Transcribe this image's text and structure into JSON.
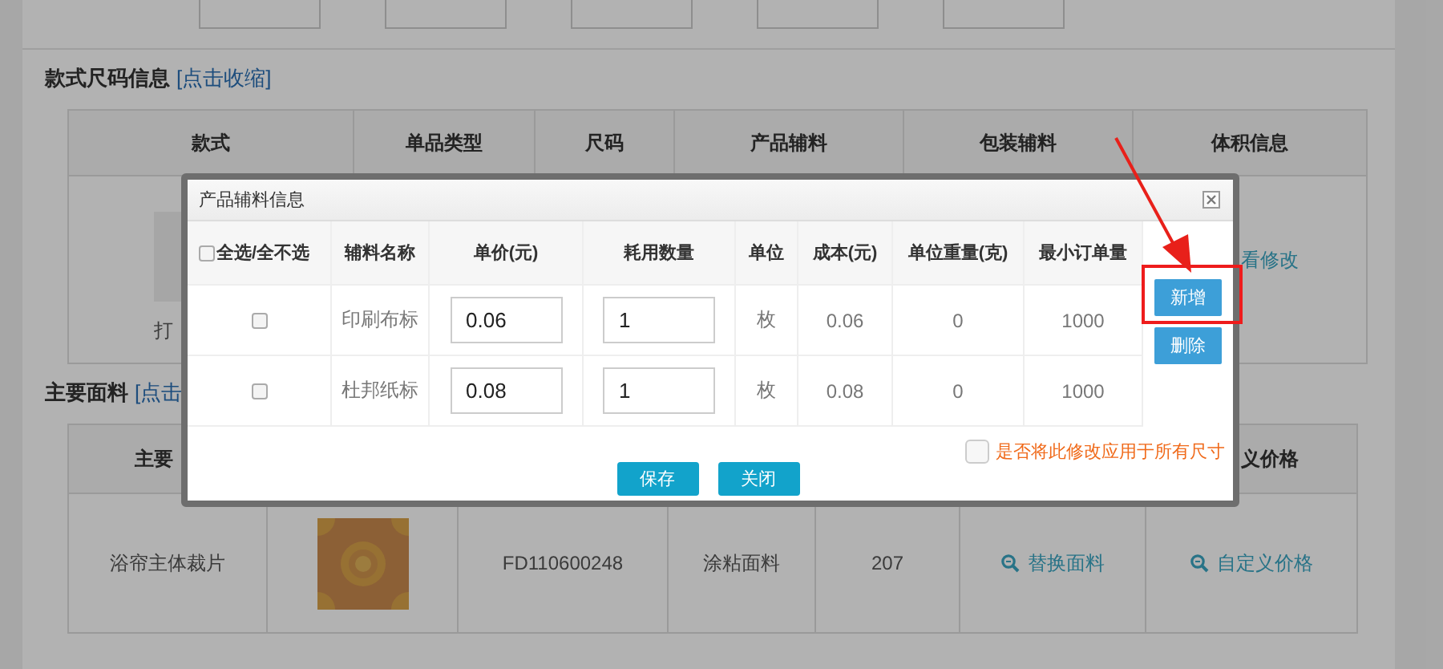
{
  "sections": [
    {
      "title": "款式尺码信息",
      "link": "[点击收缩]",
      "header": [
        {
          "kind": "text",
          "label": "款式"
        },
        {
          "kind": "text",
          "label": "单品类型"
        },
        {
          "kind": "text",
          "label": "尺码"
        },
        {
          "kind": "text",
          "label": "产品辅料"
        },
        {
          "kind": "text",
          "label": "包装辅料"
        },
        {
          "kind": "text",
          "label": "体积信息"
        }
      ],
      "rows": [
        [
          {
            "kind": "image_text",
            "text": "打"
          },
          {
            "kind": "blank"
          },
          {
            "kind": "blank"
          },
          {
            "kind": "blank"
          },
          {
            "kind": "blank"
          },
          {
            "kind": "link",
            "text": "看修改"
          }
        ]
      ]
    },
    {
      "title": "主要面料",
      "link": "[点击",
      "header": [
        {
          "kind": "text",
          "label": "主要"
        },
        {
          "kind": "blank"
        },
        {
          "kind": "blank"
        },
        {
          "kind": "blank"
        },
        {
          "kind": "blank"
        },
        {
          "kind": "blank"
        },
        {
          "kind": "text",
          "label": "义价格"
        }
      ],
      "rows": [
        [
          {
            "kind": "text",
            "text": "浴帘主体裁片"
          },
          {
            "kind": "picture"
          },
          {
            "kind": "text",
            "text": "FD110600248"
          },
          {
            "kind": "text",
            "text": "涂粘面料"
          },
          {
            "kind": "text",
            "text": "207"
          },
          {
            "kind": "icon_link",
            "text": "替换面料"
          },
          {
            "kind": "icon_link",
            "text": "自定义价格"
          }
        ]
      ]
    }
  ],
  "dialog": {
    "title": "产品辅料信息",
    "columns": [
      {
        "kind": "checkbox",
        "label": "全选/全不选",
        "checked": false
      },
      {
        "kind": "text",
        "label": "辅料名称"
      },
      {
        "kind": "text",
        "label": "单价(元)"
      },
      {
        "kind": "text",
        "label": "耗用数量"
      },
      {
        "kind": "text",
        "label": "单位"
      },
      {
        "kind": "text",
        "label": "成本(元)"
      },
      {
        "kind": "text",
        "label": "单位重量(克)"
      },
      {
        "kind": "text",
        "label": "最小订单量"
      }
    ],
    "rows": [
      {
        "checked": false,
        "name": "印刷布标",
        "price": "0.06",
        "quantity": "1",
        "unit": "枚",
        "cost": "0.06",
        "weight": "0",
        "min_order": "1000"
      },
      {
        "checked": false,
        "name": "杜邦纸标",
        "price": "0.08",
        "quantity": "1",
        "unit": "枚",
        "cost": "0.08",
        "weight": "0",
        "min_order": "1000"
      }
    ],
    "side_buttons": [
      "新增",
      "删除"
    ],
    "apply_all": {
      "label": "是否将此修改应用于所有尺寸",
      "checked": false
    },
    "buttons": [
      "保存",
      "关闭"
    ]
  }
}
